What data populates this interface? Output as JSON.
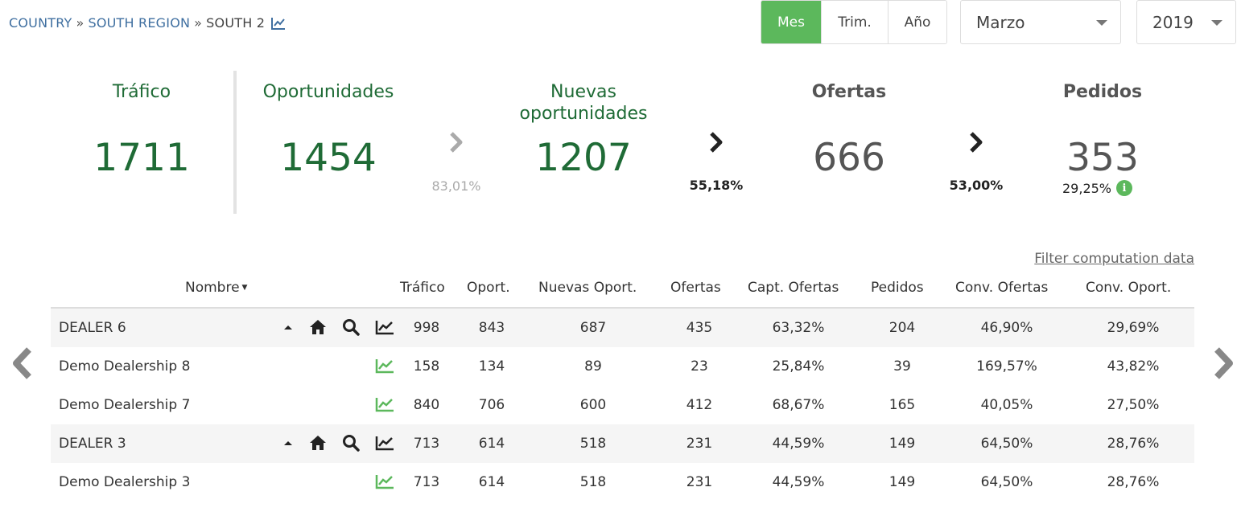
{
  "breadcrumb": {
    "country": "COUNTRY",
    "region": "SOUTH REGION",
    "current": "SOUTH 2",
    "separator": "»"
  },
  "period_toggle": {
    "month": "Mes",
    "quarter": "Trim.",
    "year": "Año",
    "active": "month"
  },
  "selects": {
    "month": "Marzo",
    "year": "2019"
  },
  "kpis": {
    "trafico": {
      "label": "Tráfico",
      "value": "1711"
    },
    "oportunidades": {
      "label": "Oportunidades",
      "value": "1454"
    },
    "nuevas": {
      "label_line1": "Nuevas",
      "label_line2": "oportunidades",
      "value": "1207"
    },
    "ofertas": {
      "label": "Ofertas",
      "value": "666"
    },
    "pedidos": {
      "label": "Pedidos",
      "value": "353",
      "pct": "29,25%"
    }
  },
  "conversions": {
    "opor_to_nuevas": "83,01%",
    "nuevas_to_ofertas": "55,18%",
    "ofertas_to_pedidos": "53,00%"
  },
  "filter_link": "Filter computation data",
  "table": {
    "headers": {
      "nombre": "Nombre",
      "trafico": "Tráfico",
      "oport": "Oport.",
      "nuevas": "Nuevas Oport.",
      "ofertas": "Ofertas",
      "capt": "Capt. Ofertas",
      "pedidos": "Pedidos",
      "conv_ofertas": "Conv. Ofertas",
      "conv_oport": "Conv. Oport."
    },
    "rows": [
      {
        "name": "DEALER 6",
        "group": true,
        "trafico": "998",
        "oport": "843",
        "nuevas": "687",
        "ofertas": "435",
        "capt": "63,32%",
        "pedidos": "204",
        "conv_ofertas": "46,90%",
        "conv_oport": "29,69%"
      },
      {
        "name": "Demo Dealership 8",
        "group": false,
        "trafico": "158",
        "oport": "134",
        "nuevas": "89",
        "ofertas": "23",
        "capt": "25,84%",
        "pedidos": "39",
        "conv_ofertas": "169,57%",
        "conv_oport": "43,82%"
      },
      {
        "name": "Demo Dealership 7",
        "group": false,
        "trafico": "840",
        "oport": "706",
        "nuevas": "600",
        "ofertas": "412",
        "capt": "68,67%",
        "pedidos": "165",
        "conv_ofertas": "40,05%",
        "conv_oport": "27,50%"
      },
      {
        "name": "DEALER 3",
        "group": true,
        "trafico": "713",
        "oport": "614",
        "nuevas": "518",
        "ofertas": "231",
        "capt": "44,59%",
        "pedidos": "149",
        "conv_ofertas": "64,50%",
        "conv_oport": "28,76%"
      },
      {
        "name": "Demo Dealership 3",
        "group": false,
        "trafico": "713",
        "oport": "614",
        "nuevas": "518",
        "ofertas": "231",
        "capt": "44,59%",
        "pedidos": "149",
        "conv_ofertas": "64,50%",
        "conv_oport": "28,76%"
      }
    ]
  },
  "icons": {
    "breadcrumb": "line-chart-icon",
    "row_group": [
      "collapse-icon",
      "home-icon",
      "search-icon",
      "line-chart-icon"
    ],
    "row_child": [
      "line-chart-icon"
    ],
    "nav": [
      "prev-arrow-icon",
      "next-arrow-icon"
    ]
  },
  "colors": {
    "accent": "#5cb85c",
    "kpi_green": "#1f6b36",
    "link": "#3f6fa0"
  }
}
